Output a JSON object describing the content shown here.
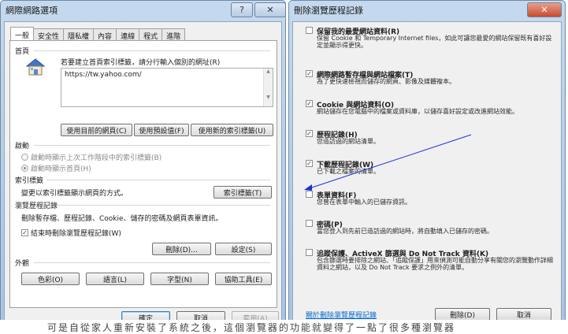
{
  "internet_options": {
    "title": "網際網路選項",
    "help": "?",
    "close": "✕",
    "tabs": [
      "一般",
      "安全性",
      "隱私權",
      "內容",
      "連線",
      "程式",
      "進階"
    ],
    "home_page": {
      "label": "首頁",
      "instruction": "若要建立首頁索引標籤，請分行輸入個別的網址(R)",
      "url": "https://tw.yahoo.com/",
      "buttons": [
        "使用目前的網頁(C)",
        "使用預設值(F)",
        "使用新的索引標籤(U)"
      ]
    },
    "startup": {
      "label": "啟動",
      "options": [
        "啟動時顯示上次工作階段中的索引標籤(B)",
        "啟動時顯示首頁(H)"
      ]
    },
    "tabs_section": {
      "label": "索引標籤",
      "text": "變更以索引標籤顯示網頁的方式。",
      "button": "索引標籤(T)"
    },
    "browsing_history": {
      "label": "瀏覽歷程記錄",
      "text": "刪除暫存檔、歷程記錄、Cookie、儲存的密碼及網頁表單資訊。",
      "checkbox": "結束時刪除瀏覽歷程記錄(W)",
      "delete_button": "刪除(D)...",
      "settings_button": "設定(S)"
    },
    "appearance": {
      "label": "外觀",
      "buttons": [
        "色彩(O)",
        "語言(L)",
        "字型(N)",
        "協助工具(E)"
      ]
    },
    "footer": {
      "ok": "確定",
      "cancel": "取消",
      "apply": "套用(A)"
    }
  },
  "delete_history": {
    "title": "刪除瀏覽歷程記錄",
    "close": "✕",
    "items": [
      {
        "title": "保留我的最愛網站資料(R)",
        "desc": "保留 Cookie 和 Temporary Internet files，如此可讓您最愛的網站保留既有喜好設定並顯示得更快。",
        "checked": false
      },
      {
        "title": "網際網路暫存檔與網站檔案(T)",
        "desc": "為了更快速檢視而儲存的網頁、影像及媒體複本。",
        "checked": true
      },
      {
        "title": "Cookie 與網站資料(O)",
        "desc": "網站儲存在您電腦中的檔案或資料庫，以儲存喜好設定或改進網站效能。",
        "checked": true
      },
      {
        "title": "歷程記錄(H)",
        "desc": "您造訪過的網站清單。",
        "checked": true
      },
      {
        "title": "下載歷程記錄(W)",
        "desc": "已下載之檔案的清單。",
        "checked": true
      },
      {
        "title": "表單資料(F)",
        "desc": "您曾在表單中輸入的已儲存資訊。",
        "checked": false
      },
      {
        "title": "密碼(P)",
        "desc": "當您登入到先前已造訪過的網站時，將自動填入已儲存的密碼。",
        "checked": false
      },
      {
        "title": "追蹤保護、ActiveX 篩選與 Do Not Track 資料(K)",
        "desc": "包含篩選時要排除之網站、「追蹤保護」用來偵測可能自動分享有關您的瀏覽動作詳細資料之網站，以及 Do Not Track 要求之例外的清單。",
        "checked": false
      }
    ],
    "link": "關於刪除瀏覽歷程記錄",
    "delete_button": "刪除(D)",
    "cancel_button": "取消"
  },
  "background_text": "可是自從家人重新安裝了系統之後，這個瀏覽器的功能就變得了一點了很多種瀏覽器"
}
